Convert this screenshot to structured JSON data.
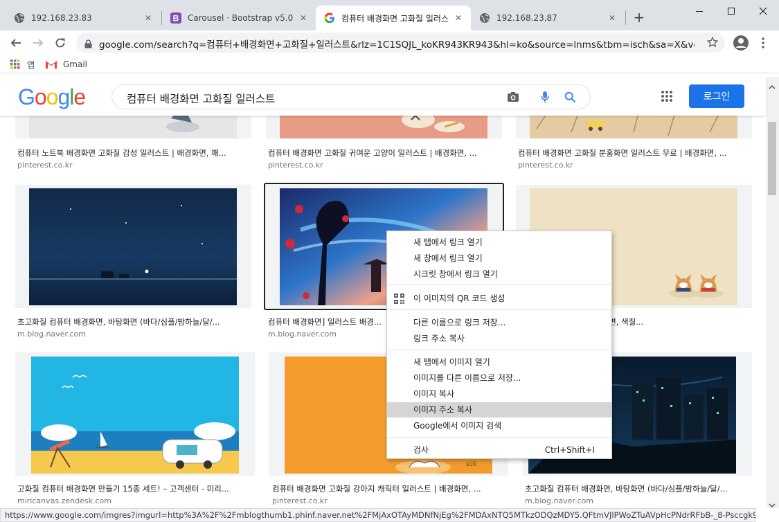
{
  "tabs": [
    {
      "title": "192.168.23.83",
      "icon": "globe-icon"
    },
    {
      "title": "Carousel · Bootstrap v5.0",
      "icon": "bootstrap-icon"
    },
    {
      "title": "컴퓨터 배경화면 고화질 일러스",
      "icon": "google-icon",
      "active": true
    },
    {
      "title": "192.168.23.87",
      "icon": "globe-icon"
    }
  ],
  "address": {
    "url": "google.com/search?q=컴퓨터+배경화면+고화질+일러스트&rlz=1C1SQJL_koKR943KR943&hl=ko&source=lnms&tbm=isch&sa=X&ved..."
  },
  "bookmarks": [
    {
      "label": "앱",
      "icon": "apps-grid-icon"
    },
    {
      "label": "Gmail",
      "icon": "gmail-icon"
    }
  ],
  "google": {
    "logo": [
      "G",
      "o",
      "o",
      "g",
      "l",
      "e"
    ],
    "logo_colors": [
      "#4285F4",
      "#EA4335",
      "#FBBC05",
      "#4285F4",
      "#34A853",
      "#EA4335"
    ],
    "query": "컴퓨터 배경화면 고화질 일러스트",
    "login": "로그인",
    "accent": "#1a73e8"
  },
  "results": [
    {
      "caption": "컴퓨터 노트북 배경화면 고화질 감성 일러스트 | 배경화면, 패...",
      "source": "pinterest.co.kr"
    },
    {
      "caption": "컴퓨터 배경화면 고화질 귀여운 고양이 일러스트 | 배경화면, ...",
      "source": "pinterest.co.kr"
    },
    {
      "caption": "컴퓨터 배경화면 고화질 분홍화면 일러스트 무료 | 배경화면, ...",
      "source": "pinterest.co.kr"
    },
    {
      "caption": "초고화질 컴퓨터 배경화면, 바탕화면 (바다/심플/밤하늘/달/...",
      "source": "m.blog.naver.com"
    },
    {
      "caption": "컴퓨터 배경화면] 일러스트 배경...",
      "source": "m.blog.naver.com"
    },
    {
      "caption": "웰시코기 일러스트 | 배경화면, 색칠...",
      "source": ""
    },
    {
      "caption": "고화질 컴퓨터 배경화면 만들기 15종 세트! – 고객센터 - 미리...",
      "source": "miricanvas.zendesk.com"
    },
    {
      "caption": "컴퓨터 배경화면 고화질 강아지 캐릭터 일러스트 | 배경화면, ...",
      "source": "pinterest.co.kr"
    },
    {
      "caption": "초고화질 컴퓨터 배경화면, 바탕화면 (바다/심플/밤하늘/달/...",
      "source": "m.blog.naver.com"
    }
  ],
  "context_menu": [
    {
      "label": "새 탭에서 링크 열기"
    },
    {
      "label": "새 창에서 링크 열기"
    },
    {
      "label": "시크릿 창에서 링크 열기"
    },
    {
      "label": "이 이미지의 QR 코드 생성",
      "icon": "qr-code-icon"
    },
    {
      "label": "다른 이름으로 링크 저장..."
    },
    {
      "label": "링크 주소 복사"
    },
    {
      "label": "새 탭에서 이미지 열기"
    },
    {
      "label": "이미지를 다른 이름으로 저장..."
    },
    {
      "label": "이미지 복사"
    },
    {
      "label": "이미지 주소 복사",
      "highlighted": true
    },
    {
      "label": "Google에서 이미지 검색"
    },
    {
      "label": "검사",
      "shortcut": "Ctrl+Shift+I"
    }
  ],
  "status": "https://www.google.com/imgres?imgurl=http%3A%2F%2Fmblogthumb1.phinf.naver.net%2FMjAxOTAyMDNfNjEg%2FMDAxNTQ5MTkzODQzMDY5.QFtmVJlPWoZTuAVpHcPNdrRFbB-_8-Psccgk9abR..."
}
